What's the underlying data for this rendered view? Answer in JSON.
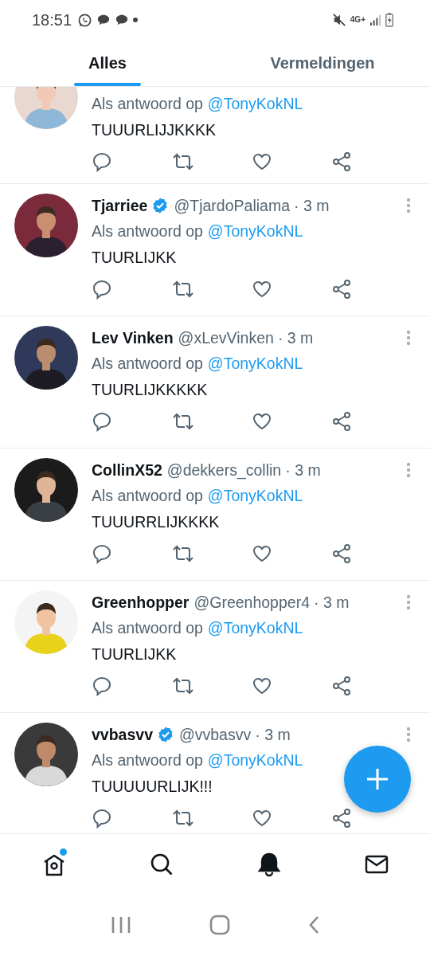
{
  "status_bar": {
    "time": "18:51",
    "network": "4G+"
  },
  "tabs": [
    {
      "label": "Alles",
      "selected": true
    },
    {
      "label": "Vermeldingen",
      "selected": false
    }
  ],
  "tweets": [
    {
      "kind": "partial",
      "reply_prefix": "Als antwoord op",
      "mention": "@TonyKokNL",
      "text": "TUUURLIJJKKKK"
    },
    {
      "kind": "full",
      "name": "Tjarriee",
      "verified": true,
      "handle": "@TjardoPaliama",
      "time": "· 3 m",
      "reply_prefix": "Als antwoord op",
      "mention": "@TonyKokNL",
      "text": "TUURLIJKK"
    },
    {
      "kind": "full",
      "name": "Lev Vinken",
      "verified": false,
      "handle": "@xLevVinken",
      "time": "· 3 m",
      "reply_prefix": "Als antwoord op",
      "mention": "@TonyKokNL",
      "text": "TUURLIJKKKKK"
    },
    {
      "kind": "full",
      "name": "CollinX52",
      "verified": false,
      "handle": "@dekkers_collin",
      "time": "· 3 m",
      "reply_prefix": "Als antwoord op",
      "mention": "@TonyKokNL",
      "text": "TUUURRLIJKKKK"
    },
    {
      "kind": "full",
      "name": "Greenhopper",
      "verified": false,
      "handle": "@Greenhopper4",
      "time": "· 3 m",
      "reply_prefix": "Als antwoord op",
      "mention": "@TonyKokNL",
      "text": "TUURLIJKK"
    },
    {
      "kind": "full",
      "name": "vvbasvv",
      "verified": true,
      "handle": "@vvbasvv",
      "time": "· 3 m",
      "reply_prefix": "Als antwoord op",
      "mention": "@TonyKokNL",
      "text": "TUUUUURLIJK!!!"
    }
  ],
  "bottom_nav": [
    {
      "kind": "home",
      "selected": false,
      "dot": true
    },
    {
      "kind": "search",
      "selected": false,
      "dot": false
    },
    {
      "kind": "notifications",
      "selected": true,
      "dot": false
    },
    {
      "kind": "messages",
      "selected": false,
      "dot": false
    }
  ]
}
